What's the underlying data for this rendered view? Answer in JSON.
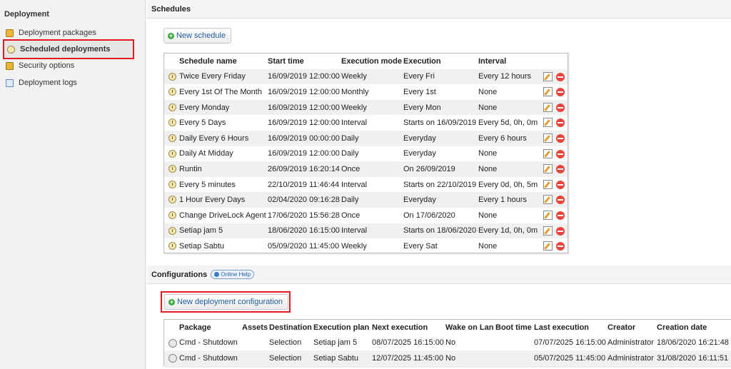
{
  "sidebar": {
    "title": "Deployment",
    "items": [
      {
        "label": "Deployment packages",
        "icon": "package-icon"
      },
      {
        "label": "Scheduled deployments",
        "icon": "clock-icon",
        "active": true
      },
      {
        "label": "Security options",
        "icon": "lock-icon"
      },
      {
        "label": "Deployment logs",
        "icon": "log-icon"
      }
    ]
  },
  "schedules": {
    "section_title": "Schedules",
    "new_button": "New schedule",
    "columns": [
      "Schedule name",
      "Start time",
      "Execution mode",
      "Execution",
      "Interval"
    ],
    "rows": [
      [
        "Twice Every Friday",
        "16/09/2019 12:00:00",
        "Weekly",
        "Every Fri",
        "Every 12 hours"
      ],
      [
        "Every 1st Of The Month",
        "16/09/2019 12:00:00",
        "Monthly",
        "Every 1st",
        "None"
      ],
      [
        "Every Monday",
        "16/09/2019 12:00:00",
        "Weekly",
        "Every Mon",
        "None"
      ],
      [
        "Every 5 Days",
        "16/09/2019 12:00:00",
        "Interval",
        "Starts on 16/09/2019",
        "Every 5d, 0h, 0m"
      ],
      [
        "Daily Every 6 Hours",
        "16/09/2019 00:00:00",
        "Daily",
        "Everyday",
        "Every 6 hours"
      ],
      [
        "Daily At Midday",
        "16/09/2019 12:00:00",
        "Daily",
        "Everyday",
        "None"
      ],
      [
        "Runtin",
        "26/09/2019 16:20:14",
        "Once",
        "On 26/09/2019",
        "None"
      ],
      [
        "Every 5 minutes",
        "22/10/2019 11:46:44",
        "Interval",
        "Starts on 22/10/2019",
        "Every 0d, 0h, 5m"
      ],
      [
        "1 Hour Every Days",
        "02/04/2020 09:16:28",
        "Daily",
        "Everyday",
        "Every 1 hours"
      ],
      [
        "Change DriveLock Agent",
        "17/06/2020 15:56:28",
        "Once",
        "On 17/06/2020",
        "None"
      ],
      [
        "Setiap jam 5",
        "18/06/2020 16:15:00",
        "Interval",
        "Starts on 18/06/2020",
        "Every 1d, 0h, 0m"
      ],
      [
        "Setiap Sabtu",
        "05/09/2020 11:45:00",
        "Weekly",
        "Every Sat",
        "None"
      ]
    ]
  },
  "configurations": {
    "section_title": "Configurations",
    "help_label": "Online Help",
    "new_button": "New deployment configuration",
    "columns": [
      "Package",
      "Assets",
      "Destination",
      "Execution plan",
      "Next execution",
      "Wake on Lan",
      "Boot time",
      "Last execution",
      "Creator",
      "Creation date"
    ],
    "rows": [
      [
        "Cmd - Shutdown",
        "",
        "Selection",
        "Setiap jam 5",
        "08/07/2025 16:15:00",
        "No",
        "",
        "07/07/2025 16:15:00",
        "Administrator",
        "18/06/2020 16:21:48"
      ],
      [
        "Cmd - Shutdown",
        "",
        "Selection",
        "Setiap Sabtu",
        "12/07/2025 11:45:00",
        "No",
        "",
        "05/07/2025 11:45:00",
        "Administrator",
        "31/08/2020 16:11:51"
      ]
    ]
  },
  "colors": {
    "highlight": "#e21b23",
    "link": "#1e5c9e"
  }
}
